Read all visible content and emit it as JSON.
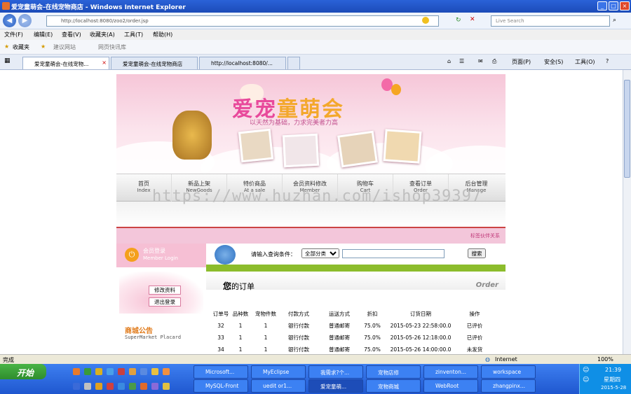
{
  "window": {
    "title": "爱宠童萌会-在线宠物商店 - Windows Internet Explorer"
  },
  "address": {
    "url": "http://localhost:8080/zoo2/order.jsp",
    "search_placeholder": "Live Search"
  },
  "menubar": [
    "文件(F)",
    "编辑(E)",
    "查看(V)",
    "收藏夹(A)",
    "工具(T)",
    "帮助(H)"
  ],
  "favbar": {
    "favorites": "收藏夹",
    "suggested": "建议网站",
    "gallery": "网页快讯库"
  },
  "tabs": [
    {
      "label": "爱宠童萌会-在线宠物..."
    },
    {
      "label": "爱宠童萌会-在线宠物商店"
    },
    {
      "label": "http://localhost:8080/..."
    }
  ],
  "tab_tools": {
    "page": "页面(P)",
    "safety": "安全(S)",
    "tools": "工具(O)"
  },
  "banner": {
    "title_a": "爱宠",
    "title_b": "童萌会",
    "slogan": "以天然为基础，力求完美者力高"
  },
  "nav": [
    {
      "zh": "首页",
      "en": "Index"
    },
    {
      "zh": "新品上架",
      "en": "NewGoods"
    },
    {
      "zh": "特价商品",
      "en": "At a sale"
    },
    {
      "zh": "会员资料修改",
      "en": "Member"
    },
    {
      "zh": "购物车",
      "en": "Cart"
    },
    {
      "zh": "查看订单",
      "en": "Order"
    },
    {
      "zh": "后台管理",
      "en": "Manage"
    }
  ],
  "pinkbar": {
    "link": "标签伙伴关系"
  },
  "sidebar": {
    "login_zh": "会员登录",
    "login_en": "Member Login",
    "edit_btn": "修改资料",
    "logout_btn": "退出登录",
    "notice_zh": "商城公告",
    "notice_en": "SuperMarket Placard"
  },
  "search": {
    "label": "请输入查询条件：",
    "category": "全部分类",
    "button": "搜索"
  },
  "order": {
    "title_a": "您",
    "title_b": "的订单",
    "title_en": "Order"
  },
  "table": {
    "headers": [
      "订单号",
      "品种数",
      "宠物件数",
      "付款方式",
      "运送方式",
      "折扣",
      "订货日期",
      "操作"
    ],
    "rows": [
      [
        "32",
        "1",
        "1",
        "银行付款",
        "普通邮寄",
        "75.0%",
        "2015-05-23 22:58:00.0",
        "已评价"
      ],
      [
        "33",
        "1",
        "1",
        "银行付款",
        "普通邮寄",
        "75.0%",
        "2015-05-26 12:18:00.0",
        "已评价"
      ],
      [
        "34",
        "1",
        "1",
        "银行付款",
        "普通邮寄",
        "75.0%",
        "2015-05-26 14:00:00.0",
        "未发货"
      ]
    ]
  },
  "watermark": "https://www.huzhan.com/ishop39397",
  "status": {
    "left": "完成",
    "zone": "Internet",
    "zoom": "100%"
  },
  "taskbar": {
    "start": "开始",
    "row1": [
      "Microsoft...",
      "MyEclipse",
      "我需求?个...",
      "宠物店修",
      "zinventon...",
      "workspace"
    ],
    "row2": [
      "MySQL-Front",
      "uedit or1...",
      "爱宠童萌...",
      "宠物商城",
      "WebRoot",
      "zhangpinx..."
    ],
    "time": "21:39",
    "day": "星期四",
    "date": "2015-5-28"
  },
  "colors": {
    "pink": "#f3c6da",
    "accent": "#e8499b",
    "green": "#8cbc2c"
  }
}
